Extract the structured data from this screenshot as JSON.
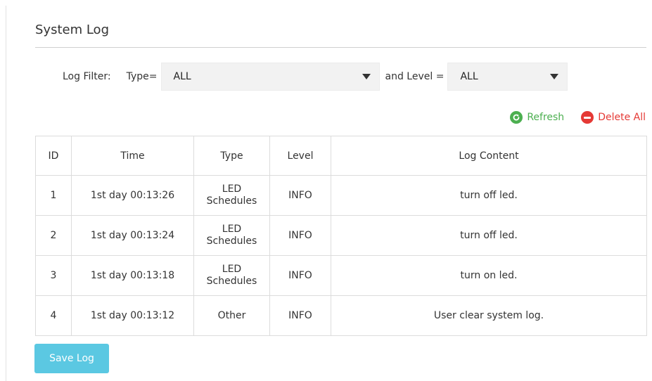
{
  "page": {
    "title": "System Log"
  },
  "filter": {
    "label": "Log Filter:",
    "type_label": "Type=",
    "type_value": "ALL",
    "level_label": "and Level =",
    "level_value": "ALL"
  },
  "actions": {
    "refresh_label": "Refresh",
    "delete_all_label": "Delete All",
    "refresh_color": "#4caf50",
    "delete_color": "#e53935"
  },
  "table": {
    "headers": [
      "ID",
      "Time",
      "Type",
      "Level",
      "Log Content"
    ],
    "rows": [
      {
        "id": "1",
        "time": "1st day 00:13:26",
        "type_line1": "LED",
        "type_line2": "Schedules",
        "level": "INFO",
        "content": "turn off led."
      },
      {
        "id": "2",
        "time": "1st day 00:13:24",
        "type_line1": "LED",
        "type_line2": "Schedules",
        "level": "INFO",
        "content": "turn off led."
      },
      {
        "id": "3",
        "time": "1st day 00:13:18",
        "type_line1": "LED",
        "type_line2": "Schedules",
        "level": "INFO",
        "content": "turn on led."
      },
      {
        "id": "4",
        "time": "1st day 00:13:12",
        "type_line1": "Other",
        "type_line2": "",
        "level": "INFO",
        "content": "User clear system log."
      }
    ]
  },
  "footer": {
    "save_label": "Save Log",
    "accent": "#5bc8e2"
  }
}
